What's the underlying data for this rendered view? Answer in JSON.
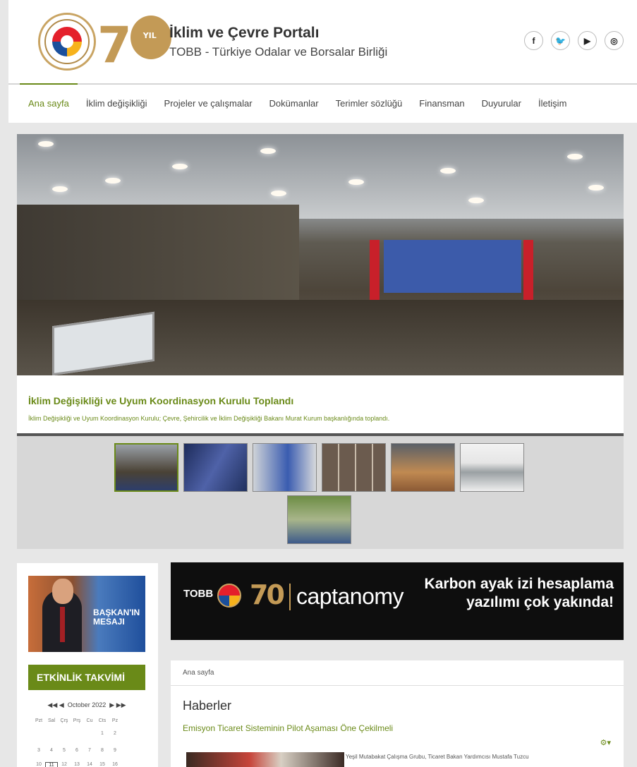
{
  "header": {
    "title": "İklim ve Çevre Portalı",
    "subtitle": "TOBB - Türkiye Odalar ve Borsalar Birliği",
    "logo_text": "70",
    "social": [
      {
        "name": "facebook-icon",
        "glyph": "f"
      },
      {
        "name": "twitter-icon",
        "glyph": "🐦"
      },
      {
        "name": "youtube-icon",
        "glyph": "▶"
      },
      {
        "name": "instagram-icon",
        "glyph": "◎"
      }
    ]
  },
  "nav": {
    "items": [
      "Ana sayfa",
      "İklim değişikliği",
      "Projeler ve çalışmalar",
      "Dokümanlar",
      "Terimler sözlüğü",
      "Finansman",
      "Duyurular",
      "İletişim"
    ],
    "active": "Ana sayfa"
  },
  "slider": {
    "title": "İklim Değişikliği ve Uyum Koordinasyon Kurulu Toplandı",
    "description": "İklim Değişikliği ve Uyum Koordinasyon Kurulu; Çevre, Şehircilik ve İklim Değişikliği Bakanı Murat Kurum başkanlığında toplandı.",
    "thumbnail_count": 7
  },
  "sidebar": {
    "president_message": "BAŞKAN'IN MESAJI",
    "events_title": "ETKİNLİK TAKVİMİ",
    "calendar": {
      "month": "October 2022",
      "prev_year": "◀◀",
      "prev_month": "◀",
      "next_month": "▶",
      "next_year": "▶▶",
      "weekdays": [
        "Pzt",
        "Sal",
        "Çrş",
        "Prş",
        "Cu",
        "Cts",
        "Pz"
      ],
      "week1": [
        "",
        "",
        "",
        "",
        "",
        "1",
        "2"
      ],
      "week2": [
        "3",
        "4",
        "5",
        "6",
        "7",
        "8",
        "9"
      ],
      "week3": [
        "10",
        "11",
        "12",
        "13",
        "14",
        "15",
        "16"
      ],
      "today": "11"
    }
  },
  "banner": {
    "brand": "TOBB",
    "logo": "70",
    "product": "captanomy",
    "message": "Karbon ayak izi hesaplama yazılımı çok yakında!"
  },
  "main": {
    "breadcrumb": "Ana sayfa",
    "heading": "Haberler",
    "article_title": "Emisyon Ticaret Sisteminin Pilot Aşaması Öne Çekilmeli",
    "article_excerpt": "Yeşil Mutabakat Çalışma Grubu, Ticaret Bakan Yardımcısı Mustafa Tuzcu"
  },
  "colors": {
    "accent": "#6a8a18",
    "gold": "#c39a56",
    "banner_bg": "#0e0e0e"
  }
}
